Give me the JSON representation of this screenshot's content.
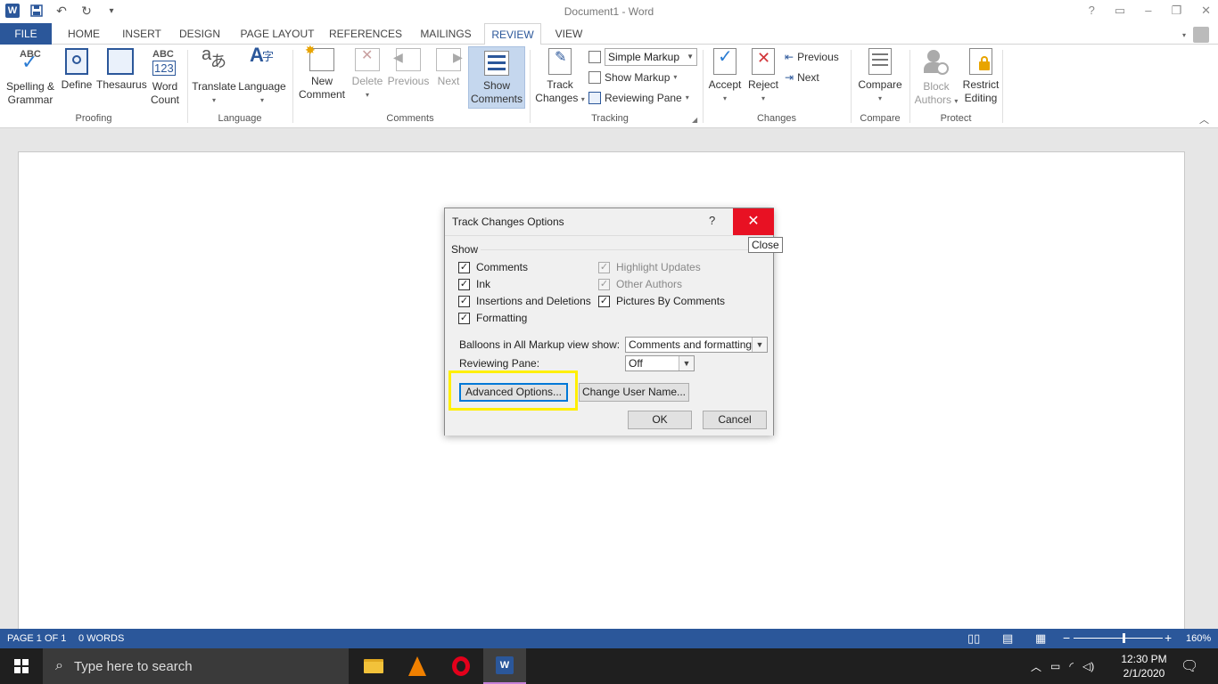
{
  "title_bar": {
    "app_logo_letter": "W",
    "document_title": "Document1 - Word",
    "help": "?"
  },
  "tabs": [
    {
      "label": "FILE"
    },
    {
      "label": "HOME"
    },
    {
      "label": "INSERT"
    },
    {
      "label": "DESIGN"
    },
    {
      "label": "PAGE LAYOUT"
    },
    {
      "label": "REFERENCES"
    },
    {
      "label": "MAILINGS"
    },
    {
      "label": "REVIEW"
    },
    {
      "label": "VIEW"
    }
  ],
  "ribbon": {
    "proofing": {
      "group_label": "Proofing",
      "spelling": "Spelling &",
      "spelling2": "Grammar",
      "define": "Define",
      "thesaurus": "Thesaurus",
      "word_count": "Word",
      "word_count2": "Count",
      "abc": "ABC",
      "abc123": "123"
    },
    "language": {
      "group_label": "Language",
      "translate": "Translate",
      "language": "Language"
    },
    "comments": {
      "group_label": "Comments",
      "new_comment": "New",
      "new_comment2": "Comment",
      "delete": "Delete",
      "previous": "Previous",
      "next": "Next",
      "show_comments": "Show",
      "show_comments2": "Comments"
    },
    "tracking": {
      "group_label": "Tracking",
      "track_changes": "Track",
      "track_changes2": "Changes",
      "markup_select": "Simple Markup",
      "show_markup": "Show Markup",
      "reviewing_pane": "Reviewing Pane"
    },
    "changes": {
      "group_label": "Changes",
      "accept": "Accept",
      "reject": "Reject",
      "previous": "Previous",
      "next": "Next"
    },
    "compare": {
      "group_label": "Compare",
      "compare": "Compare"
    },
    "protect": {
      "group_label": "Protect",
      "block_authors": "Block",
      "block_authors2": "Authors",
      "restrict_editing": "Restrict",
      "restrict_editing2": "Editing"
    }
  },
  "dialog": {
    "title": "Track Changes Options",
    "help": "?",
    "close_tooltip": "Close",
    "show_label": "Show",
    "checkboxes": [
      {
        "label": "Comments",
        "checked": true,
        "enabled": true
      },
      {
        "label": "Ink",
        "checked": true,
        "enabled": true
      },
      {
        "label": "Insertions and Deletions",
        "checked": true,
        "enabled": true
      },
      {
        "label": "Formatting",
        "checked": true,
        "enabled": true
      },
      {
        "label": "Highlight Updates",
        "checked": true,
        "enabled": false
      },
      {
        "label": "Other Authors",
        "checked": true,
        "enabled": false
      },
      {
        "label": "Pictures By Comments",
        "checked": true,
        "enabled": true
      }
    ],
    "balloons_label": "Balloons in All Markup view show:",
    "balloons_value": "Comments and formatting",
    "reviewing_pane_label": "Reviewing Pane:",
    "reviewing_pane_value": "Off",
    "advanced_button": "Advanced Options...",
    "change_user_button": "Change User Name...",
    "ok_button": "OK",
    "cancel_button": "Cancel"
  },
  "status_bar": {
    "page": "PAGE 1 OF 1",
    "words": "0 WORDS",
    "zoom": "160%",
    "zoom_minus": "−",
    "zoom_plus": "+"
  },
  "taskbar": {
    "search_placeholder": "Type here to search",
    "time": "12:30 PM",
    "date": "2/1/2020"
  },
  "colors": {
    "word_blue": "#2b579a",
    "close_red": "#e81123",
    "highlight_yellow": "#ffef00",
    "taskbar": "#1f1f1f"
  }
}
